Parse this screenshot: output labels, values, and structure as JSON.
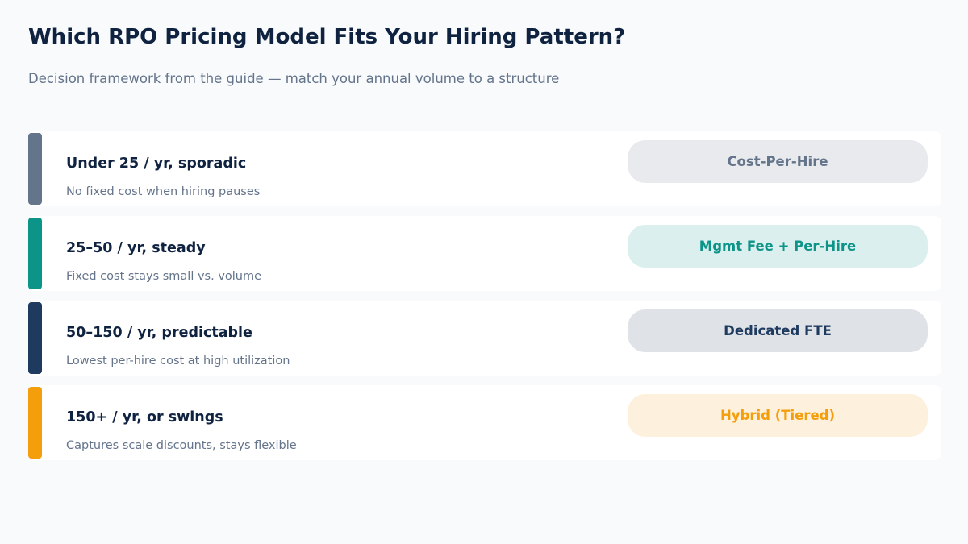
{
  "header": {
    "title": "Which RPO Pricing Model Fits Your Hiring Pattern?",
    "subtitle": "Decision framework from the guide — match your annual volume to a structure"
  },
  "rows": [
    {
      "volume": "Under 25 / yr, sporadic",
      "rationale": "No fixed cost when hiring pauses",
      "model": "Cost-Per-Hire",
      "accent_color": "#64748b"
    },
    {
      "volume": "25–50 / yr, steady",
      "rationale": "Fixed cost stays small vs. volume",
      "model": "Mgmt Fee + Per-Hire",
      "accent_color": "#0d9488"
    },
    {
      "volume": "50–150 / yr, predictable",
      "rationale": "Lowest per-hire cost at high utilization",
      "model": "Dedicated FTE",
      "accent_color": "#1e3a5f"
    },
    {
      "volume": "150+ / yr, or swings",
      "rationale": "Captures scale discounts, stays flexible",
      "model": "Hybrid (Tiered)",
      "accent_color": "#f59e0b"
    }
  ]
}
